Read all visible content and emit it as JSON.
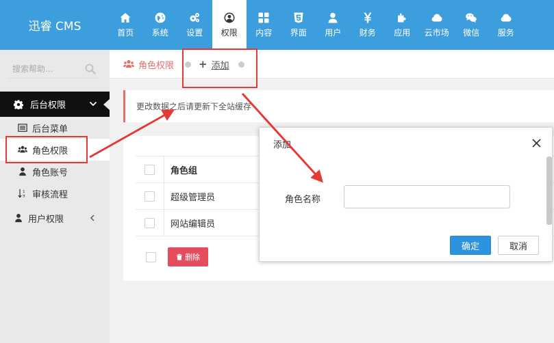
{
  "app": {
    "logo": "迅睿 CMS"
  },
  "nav": [
    {
      "label": "首页",
      "icon": "home-icon"
    },
    {
      "label": "系统",
      "icon": "globe-icon"
    },
    {
      "label": "设置",
      "icon": "cogs-icon"
    },
    {
      "label": "权限",
      "icon": "user-circle-icon",
      "active": true
    },
    {
      "label": "内容",
      "icon": "grid-icon"
    },
    {
      "label": "界面",
      "icon": "html5-icon"
    },
    {
      "label": "用户",
      "icon": "user-icon"
    },
    {
      "label": "财务",
      "icon": "yen-icon"
    },
    {
      "label": "应用",
      "icon": "puzzle-icon"
    },
    {
      "label": "云市场",
      "icon": "cloud-icon"
    },
    {
      "label": "微信",
      "icon": "wechat-icon"
    },
    {
      "label": "服务",
      "icon": "cloud-icon"
    }
  ],
  "sidebar": {
    "search_placeholder": "搜索帮助...",
    "group_title": "后台权限",
    "items": [
      {
        "label": "后台菜单",
        "icon": "list-icon"
      },
      {
        "label": "角色权限",
        "icon": "users-icon",
        "active": true
      },
      {
        "label": "角色账号",
        "icon": "user-icon"
      },
      {
        "label": "审核流程",
        "icon": "sort-numeric-icon"
      }
    ],
    "user_group": "用户权限"
  },
  "tabs": {
    "current": "角色权限",
    "add": "添加"
  },
  "notice": "更改数据之后请更新下全站缓存",
  "table": {
    "header": "角色组",
    "rows": [
      "超级管理员",
      "网站编辑员"
    ],
    "delete_label": "删除"
  },
  "dialog": {
    "title": "添加",
    "field_label": "角色名称",
    "field_value": "",
    "ok_label": "确定",
    "cancel_label": "取消"
  },
  "colors": {
    "topbar": "#3c9edd",
    "accent_red": "#e0716d",
    "danger": "#e54c5e",
    "primary": "#2c93de",
    "annotation": "#e53935"
  }
}
